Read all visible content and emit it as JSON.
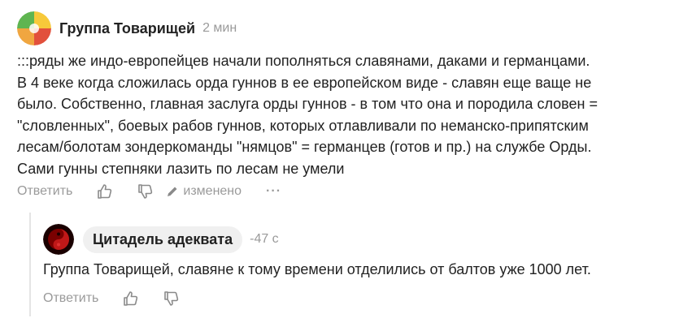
{
  "comment": {
    "author": "Группа Товарищей",
    "time": "2 мин",
    "text_lines": [
      ":::ряды же индо-европейцев начали пополняться славянами, даками и германцами.",
      "В 4 веке когда сложилась орда гуннов в ее европейском виде - славян еще ваще не",
      "было. Собственно, главная заслуга орды гуннов - в том что она и породила словен =",
      "\"словленных\", боевых рабов гуннов, которых отлавливали по неманско-припятским",
      "лесам/болотам зондеркоманды \"нямцов\" = германцев (готов и пр.) на службе Орды.",
      "Сами гунны степняки лазить по лесам не умели"
    ],
    "actions": {
      "reply": "Ответить",
      "edited": "изменено",
      "more": "···"
    }
  },
  "reply": {
    "author": "Цитадель адеквата",
    "time": "-47 с",
    "text": "Группа Товарищей, славяне к тому времени отделились от балтов уже 1000 лет.",
    "actions": {
      "reply": "Ответить"
    }
  },
  "colors": {
    "text": "#222222",
    "muted": "#9a9a9a",
    "pill_bg": "#f0f0f0",
    "thread_line": "#e4e4e4"
  },
  "icons": [
    "thumbs-up-icon",
    "thumbs-down-icon",
    "pencil-icon",
    "more-icon",
    "pinwheel-avatar",
    "yin-yang-avatar"
  ]
}
